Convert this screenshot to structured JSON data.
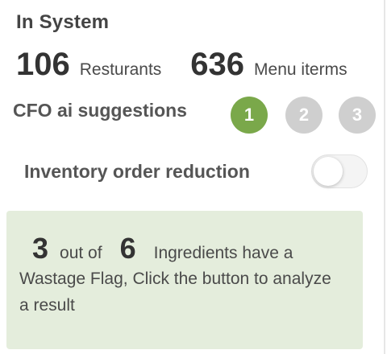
{
  "header": {
    "title": "In System"
  },
  "stats": {
    "restaurants_count": "106",
    "restaurants_label": "Resturants",
    "menu_items_count": "636",
    "menu_items_label": "Menu iterms"
  },
  "suggestions": {
    "label": "CFO ai suggestions",
    "steps": [
      "1",
      "2",
      "3"
    ],
    "active_step": 1,
    "active_color": "#7aa84a",
    "inactive_color": "#cfcfcf"
  },
  "inventory": {
    "label": "Inventory order reduction",
    "toggle_on": false
  },
  "info": {
    "flagged_count": "3",
    "out_of_text": "out of",
    "total_count": "6",
    "line1_tail": "Ingredients have a",
    "rest_text": "Wastage Flag, Click the button to analyze  a result",
    "background_color": "#e4eddc"
  }
}
